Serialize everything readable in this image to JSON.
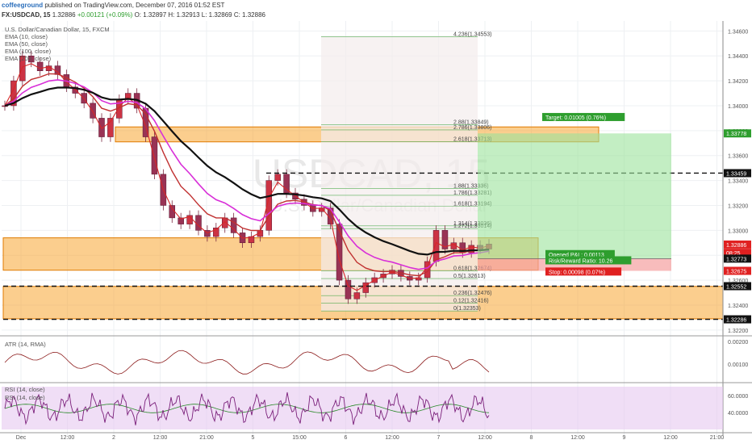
{
  "header": {
    "user": "coffeeground",
    "published": "published on TradingView.com, December 07, 2016 01:52 EST",
    "symbol": "FX:USDCAD, 15",
    "last": "1.32886",
    "change": "+0.00121 (+0.09%)",
    "open": "O: 1.32897",
    "high": "H: 1.32913",
    "low": "L: 1.32869",
    "close": "C: 1.32886"
  },
  "legend": {
    "pair_title": "U.S. Dollar/Canadian Dollar, 15, FXCM",
    "ema10": "EMA (10, close)",
    "ema50": "EMA (50, close)",
    "ema100": "EMA (100, close)",
    "ema200": "EMA (200, close)"
  },
  "watermark": {
    "main": "USDCAD, 15",
    "sub": "U.S. Dollar/Canadian Dollar"
  },
  "colors": {
    "ema10": "#d62728",
    "ema50": "#c03030",
    "ema100": "#d82fd8",
    "ema200": "#111111",
    "zone": "#f7a531",
    "zone_border": "#e07b00",
    "target": "#2e9e2e",
    "stop": "#e02020",
    "fib": "#2e9e2e",
    "candle_up": "#cc3344",
    "candle_down": "#993355",
    "atr_line": "#8b1a1a",
    "rsi_line": "#7a1f7a",
    "rsi_ma": "#2a8a2a"
  },
  "panels": {
    "atr_label": "ATR (14, RMA)",
    "rsi_label": "RSI (14, close)",
    "rsi_label2": "RSI (14, close)"
  },
  "chart_data": {
    "type": "candlestick",
    "title": "U.S. Dollar/Canadian Dollar, 15, FXCM",
    "ylim": [
      1.3216,
      1.3468
    ],
    "price_ticks": [
      "1.34600",
      "1.34400",
      "1.34200",
      "1.34000",
      "1.33800",
      "1.33600",
      "1.33400",
      "1.33200",
      "1.33000",
      "1.32800",
      "1.32600",
      "1.32400",
      "1.32200"
    ],
    "price_tick_values": [
      1.346,
      1.344,
      1.342,
      1.34,
      1.338,
      1.336,
      1.334,
      1.332,
      1.33,
      1.328,
      1.326,
      1.324,
      1.322
    ],
    "time_ticks": [
      "Dec",
      "12:00",
      "2",
      "12:00",
      "21:00",
      "5",
      "15:00",
      "6",
      "12:00",
      "7",
      "12:00",
      "8",
      "12:00",
      "9",
      "12:00",
      "21:00"
    ],
    "price_labels": [
      {
        "text": "1.33778",
        "value": 1.33778,
        "color": "#2e9e2e"
      },
      {
        "text": "1.33459",
        "value": 1.33459,
        "color": "#111111"
      },
      {
        "text": "1.32886",
        "value": 1.32886,
        "color": "#e02020"
      },
      {
        "text": "08:25",
        "value": 1.3282,
        "color": "#e02020"
      },
      {
        "text": "1.32773",
        "value": 1.32773,
        "color": "#111111"
      },
      {
        "text": "1.32675",
        "value": 1.32675,
        "color": "#e02020"
      },
      {
        "text": "1.32552",
        "value": 1.32552,
        "color": "#111111"
      },
      {
        "text": "1.32286",
        "value": 1.32286,
        "color": "#111111"
      }
    ],
    "zones": [
      {
        "name": "upper-zone",
        "top": 1.3383,
        "bottom": 1.3371
      },
      {
        "name": "middle-zone",
        "top": 1.3294,
        "bottom": 1.3268
      },
      {
        "name": "lower-zone",
        "top": 1.3255,
        "bottom": 1.3229
      }
    ],
    "dashed_levels": [
      1.33459,
      1.32552,
      1.32286
    ],
    "fib_levels": [
      {
        "text": "4.236(1.34553)",
        "value": 1.34553
      },
      {
        "text": "2.88(1.33849)",
        "value": 1.33849
      },
      {
        "text": "2.786(1.33806)",
        "value": 1.33806
      },
      {
        "text": "2.618(1.33713)",
        "value": 1.33713
      },
      {
        "text": "1.88(1.33336)",
        "value": 1.33336
      },
      {
        "text": "1.786(1.33281)",
        "value": 1.33281
      },
      {
        "text": "1.618(1.33194)",
        "value": 1.33194
      },
      {
        "text": "1.314(1.33036)",
        "value": 1.33036
      },
      {
        "text": "1.272(1.33014)",
        "value": 1.33014
      },
      {
        "text": "0.618(1.32674)",
        "value": 1.32674
      },
      {
        "text": "0.5(1.32613)",
        "value": 1.32613
      },
      {
        "text": "0.236(1.32476)",
        "value": 1.32476
      },
      {
        "text": "0.12(1.32416)",
        "value": 1.32416
      },
      {
        "text": "0(1.32353)",
        "value": 1.32353
      }
    ],
    "position": {
      "target_label": "Target: 0.01005 (0.76%)",
      "pnl_label": "Opened P&L: 0.00113",
      "rr_label": "Risk/Reward Ratio: 10.26",
      "stop_label": "Stop: 0.00098 (0.07%)",
      "entry": 1.32773,
      "target": 1.33778,
      "stop": 1.32675
    },
    "close_series": [
      1.34,
      1.342,
      1.344,
      1.3435,
      1.3428,
      1.3432,
      1.3425,
      1.3415,
      1.341,
      1.3402,
      1.339,
      1.3375,
      1.339,
      1.3405,
      1.341,
      1.3398,
      1.3375,
      1.3345,
      1.332,
      1.331,
      1.3305,
      1.3312,
      1.33,
      1.3295,
      1.3302,
      1.331,
      1.3298,
      1.329,
      1.3295,
      1.33,
      1.334,
      1.3345,
      1.333,
      1.3325,
      1.332,
      1.3315,
      1.3318,
      1.3305,
      1.326,
      1.3245,
      1.325,
      1.3258,
      1.3262,
      1.3265,
      1.3268,
      1.3263,
      1.326,
      1.3262,
      1.3275,
      1.33,
      1.3285,
      1.329,
      1.3282,
      1.3288,
      1.3285,
      1.3289
    ],
    "atr_ticks": [
      "0.00200",
      "0.00100"
    ],
    "rsi_ticks": [
      "60.0000",
      "40.0000"
    ]
  }
}
